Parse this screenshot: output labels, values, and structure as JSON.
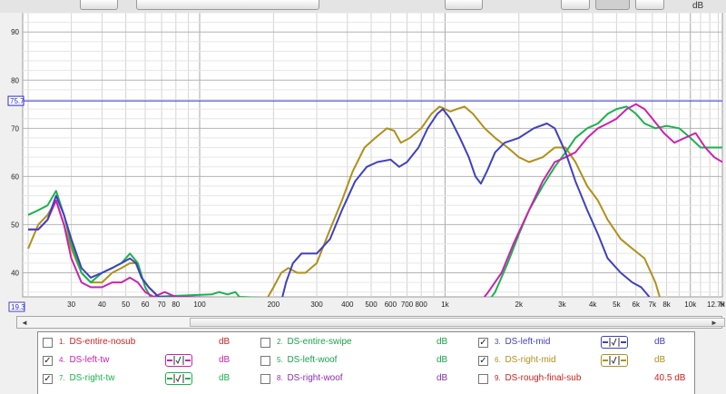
{
  "window": {
    "y_unit": "dB"
  },
  "chart_data": {
    "type": "line",
    "x_scale": "log",
    "xlim": [
      19,
      13500
    ],
    "ylim": [
      35,
      94
    ],
    "y_ticks": [
      {
        "v": 90,
        "label": "90"
      },
      {
        "v": 80,
        "label": "80"
      },
      {
        "v": 70,
        "label": "70"
      },
      {
        "v": 60,
        "label": "60"
      },
      {
        "v": 50,
        "label": "50"
      },
      {
        "v": 40,
        "label": "40"
      }
    ],
    "x_ticks": [
      {
        "v": 30,
        "label": "30"
      },
      {
        "v": 40,
        "label": "40"
      },
      {
        "v": 50,
        "label": "50"
      },
      {
        "v": 60,
        "label": "60"
      },
      {
        "v": 70,
        "label": "70"
      },
      {
        "v": 80,
        "label": "80"
      },
      {
        "v": 100,
        "label": "100"
      },
      {
        "v": 200,
        "label": "200"
      },
      {
        "v": 300,
        "label": "300"
      },
      {
        "v": 400,
        "label": "400"
      },
      {
        "v": 500,
        "label": "500"
      },
      {
        "v": 600,
        "label": "600"
      },
      {
        "v": 700,
        "label": "700"
      },
      {
        "v": 800,
        "label": "800"
      },
      {
        "v": 1000,
        "label": "1k"
      },
      {
        "v": 2000,
        "label": "2k"
      },
      {
        "v": 3000,
        "label": "3k"
      },
      {
        "v": 4000,
        "label": "4k"
      },
      {
        "v": 5000,
        "label": "5k"
      },
      {
        "v": 6000,
        "label": "6k"
      },
      {
        "v": 7000,
        "label": "7k"
      },
      {
        "v": 8000,
        "label": "8k"
      },
      {
        "v": 10000,
        "label": "10k"
      },
      {
        "v": 12700,
        "label": "12.7k"
      }
    ],
    "x_unit_label": "H",
    "y_min_readout": "19.3",
    "reference_line": {
      "value": 75.7,
      "label": "75.7",
      "color": "#2a2acc"
    },
    "series": [
      {
        "name": "DS-right-mid",
        "color": "#b0901a",
        "points": [
          [
            20,
            45
          ],
          [
            22,
            50
          ],
          [
            24,
            52
          ],
          [
            26,
            55
          ],
          [
            28,
            50
          ],
          [
            30,
            45
          ],
          [
            33,
            40
          ],
          [
            36,
            38
          ],
          [
            40,
            38
          ],
          [
            44,
            40
          ],
          [
            48,
            41
          ],
          [
            52,
            42
          ],
          [
            55,
            42
          ],
          [
            58,
            39
          ],
          [
            62,
            37
          ],
          [
            68,
            35
          ],
          [
            180,
            34
          ],
          [
            190,
            35
          ],
          [
            200,
            37
          ],
          [
            215,
            40
          ],
          [
            230,
            41
          ],
          [
            250,
            40
          ],
          [
            270,
            40
          ],
          [
            300,
            42
          ],
          [
            340,
            49
          ],
          [
            380,
            55
          ],
          [
            420,
            61
          ],
          [
            470,
            66
          ],
          [
            520,
            68
          ],
          [
            580,
            70
          ],
          [
            620,
            69.5
          ],
          [
            660,
            67
          ],
          [
            720,
            68
          ],
          [
            800,
            70
          ],
          [
            880,
            73
          ],
          [
            950,
            74.5
          ],
          [
            1000,
            74
          ],
          [
            1050,
            73.5
          ],
          [
            1120,
            74
          ],
          [
            1200,
            74.5
          ],
          [
            1300,
            73
          ],
          [
            1450,
            70
          ],
          [
            1600,
            68
          ],
          [
            1800,
            66
          ],
          [
            2000,
            64
          ],
          [
            2200,
            63
          ],
          [
            2500,
            64
          ],
          [
            2800,
            66
          ],
          [
            3100,
            66
          ],
          [
            3400,
            63
          ],
          [
            3800,
            58
          ],
          [
            4200,
            55
          ],
          [
            4600,
            51
          ],
          [
            5200,
            47
          ],
          [
            5800,
            45
          ],
          [
            6500,
            43
          ],
          [
            7200,
            38
          ],
          [
            7600,
            34
          ]
        ]
      },
      {
        "name": "DS-right-tw",
        "color": "#19b34c",
        "points": [
          [
            20,
            52
          ],
          [
            22,
            53
          ],
          [
            24,
            54
          ],
          [
            26,
            57
          ],
          [
            28,
            52
          ],
          [
            30,
            46
          ],
          [
            33,
            40
          ],
          [
            36,
            38
          ],
          [
            40,
            40
          ],
          [
            44,
            41
          ],
          [
            48,
            42
          ],
          [
            52,
            44
          ],
          [
            56,
            42
          ],
          [
            60,
            37
          ],
          [
            63,
            35
          ],
          [
            112,
            35.5
          ],
          [
            120,
            36
          ],
          [
            130,
            35.5
          ],
          [
            140,
            36
          ],
          [
            145,
            35
          ],
          [
            1450,
            33
          ],
          [
            1600,
            36
          ],
          [
            1800,
            42
          ],
          [
            2000,
            48
          ],
          [
            2200,
            53
          ],
          [
            2500,
            58
          ],
          [
            2800,
            62
          ],
          [
            3100,
            65
          ],
          [
            3400,
            68
          ],
          [
            3800,
            70
          ],
          [
            4200,
            71
          ],
          [
            4600,
            73
          ],
          [
            5000,
            74
          ],
          [
            5500,
            74.5
          ],
          [
            6000,
            73
          ],
          [
            6500,
            71
          ],
          [
            7200,
            70
          ],
          [
            8000,
            70.5
          ],
          [
            9000,
            70
          ],
          [
            10000,
            68
          ],
          [
            11000,
            66
          ],
          [
            12000,
            66
          ],
          [
            13500,
            66
          ]
        ]
      },
      {
        "name": "DS-left-tw",
        "color": "#cc22b0",
        "points": [
          [
            20,
            49
          ],
          [
            22,
            49
          ],
          [
            24,
            51
          ],
          [
            26,
            55
          ],
          [
            28,
            50
          ],
          [
            30,
            43
          ],
          [
            33,
            38
          ],
          [
            36,
            37
          ],
          [
            40,
            37
          ],
          [
            44,
            38
          ],
          [
            48,
            38
          ],
          [
            52,
            39
          ],
          [
            56,
            38
          ],
          [
            60,
            36
          ],
          [
            65,
            35
          ],
          [
            72,
            36
          ],
          [
            80,
            35
          ],
          [
            88,
            35
          ],
          [
            1350,
            33
          ],
          [
            1500,
            36
          ],
          [
            1700,
            40
          ],
          [
            1900,
            46
          ],
          [
            2200,
            53
          ],
          [
            2500,
            59
          ],
          [
            2800,
            63
          ],
          [
            3100,
            64
          ],
          [
            3400,
            65
          ],
          [
            3800,
            68
          ],
          [
            4200,
            70
          ],
          [
            4600,
            71
          ],
          [
            5000,
            72
          ],
          [
            5500,
            74
          ],
          [
            6000,
            75
          ],
          [
            6500,
            74
          ],
          [
            7000,
            72
          ],
          [
            7800,
            69
          ],
          [
            8600,
            67
          ],
          [
            9500,
            68
          ],
          [
            10500,
            69
          ],
          [
            11500,
            66
          ],
          [
            12500,
            64
          ],
          [
            13500,
            63
          ]
        ]
      },
      {
        "name": "DS-left-mid",
        "color": "#4040c0",
        "points": [
          [
            20,
            49
          ],
          [
            22,
            49
          ],
          [
            24,
            51
          ],
          [
            26,
            56
          ],
          [
            28,
            52
          ],
          [
            30,
            47
          ],
          [
            33,
            41
          ],
          [
            36,
            39
          ],
          [
            40,
            40
          ],
          [
            44,
            41
          ],
          [
            48,
            42
          ],
          [
            52,
            43
          ],
          [
            55,
            42
          ],
          [
            58,
            39
          ],
          [
            62,
            37
          ],
          [
            68,
            35
          ],
          [
            215,
            34
          ],
          [
            225,
            38
          ],
          [
            240,
            42
          ],
          [
            260,
            44
          ],
          [
            280,
            44
          ],
          [
            300,
            44
          ],
          [
            340,
            47
          ],
          [
            380,
            53
          ],
          [
            430,
            59
          ],
          [
            480,
            62
          ],
          [
            530,
            63
          ],
          [
            600,
            63.5
          ],
          [
            650,
            62
          ],
          [
            700,
            63
          ],
          [
            780,
            66
          ],
          [
            850,
            70
          ],
          [
            930,
            73
          ],
          [
            980,
            74
          ],
          [
            1050,
            72
          ],
          [
            1150,
            68
          ],
          [
            1250,
            64
          ],
          [
            1330,
            60
          ],
          [
            1400,
            58.5
          ],
          [
            1480,
            61
          ],
          [
            1600,
            65
          ],
          [
            1750,
            67
          ],
          [
            2000,
            68
          ],
          [
            2300,
            70
          ],
          [
            2600,
            71
          ],
          [
            2800,
            70
          ],
          [
            3100,
            65
          ],
          [
            3400,
            59
          ],
          [
            3800,
            53
          ],
          [
            4200,
            48
          ],
          [
            4600,
            43
          ],
          [
            5200,
            40
          ],
          [
            5800,
            38
          ],
          [
            6300,
            37
          ],
          [
            6800,
            35
          ]
        ]
      }
    ]
  },
  "scrollbar": {
    "left_arrow": "◄",
    "right_arrow": "►"
  },
  "legend": {
    "rows": [
      [
        {
          "num": "1.",
          "name": "DS-entire-nosub",
          "color": "#cc2222",
          "checked": false,
          "icon": false,
          "unit": "dB"
        },
        {
          "num": "2.",
          "name": "DS-entire-swipe",
          "color": "#19a34a",
          "checked": false,
          "icon": false,
          "unit": "dB"
        },
        {
          "num": "3.",
          "name": "DS-left-mid",
          "color": "#4040c0",
          "checked": true,
          "icon": true,
          "unit": "dB"
        }
      ],
      [
        {
          "num": "4.",
          "name": "DS-left-tw",
          "color": "#cc22b0",
          "checked": true,
          "icon": true,
          "unit": "dB"
        },
        {
          "num": "5.",
          "name": "DS-left-woof",
          "color": "#19a34a",
          "checked": false,
          "icon": false,
          "unit": "dB"
        },
        {
          "num": "6.",
          "name": "DS-right-mid",
          "color": "#b0901a",
          "checked": true,
          "icon": true,
          "unit": "dB"
        }
      ],
      [
        {
          "num": "7.",
          "name": "DS-right-tw",
          "color": "#19b34c",
          "checked": true,
          "icon": true,
          "unit": "dB"
        },
        {
          "num": "8.",
          "name": "DS-right-woof",
          "color": "#8a30b0",
          "checked": false,
          "icon": false,
          "unit": "dB"
        },
        {
          "num": "9.",
          "name": "DS-rough-final-sub",
          "color": "#cc2222",
          "checked": false,
          "icon": false,
          "unit": "40.5 dB"
        }
      ]
    ],
    "check_mark": "✓"
  }
}
